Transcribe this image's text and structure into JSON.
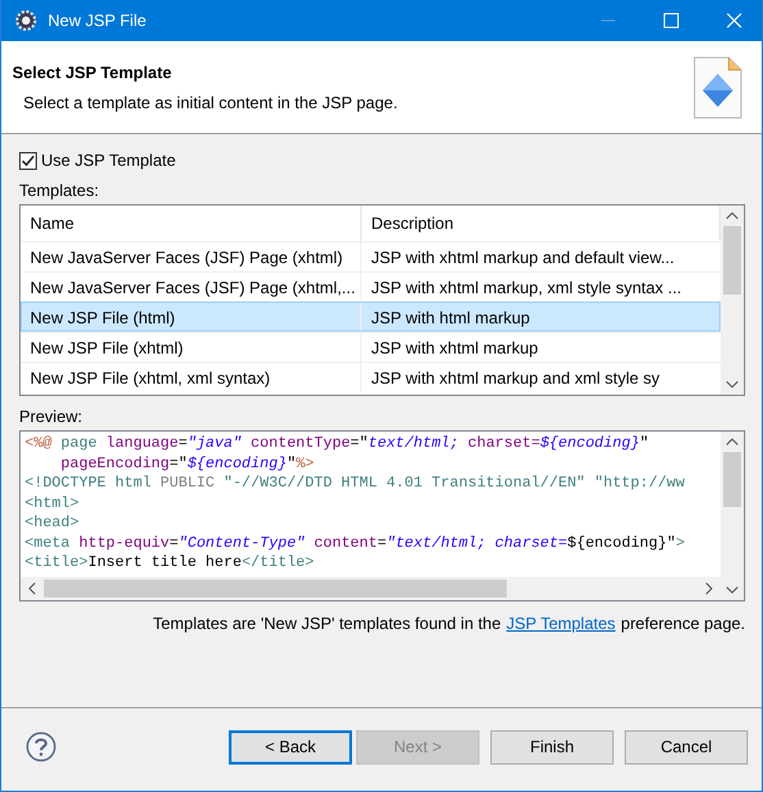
{
  "window": {
    "title": "New JSP File"
  },
  "header": {
    "title": "Select JSP Template",
    "description": "Select a template as initial content in the JSP page."
  },
  "use_template": {
    "label": "Use JSP Template",
    "checked": true
  },
  "templates_label": "Templates:",
  "table": {
    "columns": [
      "Name",
      "Description"
    ],
    "rows": [
      {
        "name": "New JavaServer Faces (JSF) Page (xhtml)",
        "description": "JSP with xhtml markup and default view...",
        "selected": false
      },
      {
        "name": "New JavaServer Faces (JSF) Page (xhtml,...",
        "description": "JSP with xhtml markup, xml style syntax ...",
        "selected": false
      },
      {
        "name": "New JSP File (html)",
        "description": "JSP with html markup",
        "selected": true
      },
      {
        "name": "New JSP File (xhtml)",
        "description": "JSP with xhtml markup",
        "selected": false
      },
      {
        "name": "New JSP File (xhtml, xml syntax)",
        "description": "JSP with xhtml markup and xml style sy",
        "selected": false
      }
    ]
  },
  "preview_label": "Preview:",
  "preview_lines": [
    [
      {
        "text": "<%@",
        "kind": "delim"
      },
      {
        "text": " page ",
        "kind": "tag"
      },
      {
        "text": "language",
        "kind": "attr"
      },
      {
        "text": "=",
        "kind": "plain"
      },
      {
        "text": "\"java\"",
        "kind": "value"
      },
      {
        "text": " contentType",
        "kind": "attr"
      },
      {
        "text": "=\"",
        "kind": "plain"
      },
      {
        "text": "text/html;",
        "kind": "value"
      },
      {
        "text": " charset=",
        "kind": "attr"
      },
      {
        "text": "${encoding}",
        "kind": "value"
      },
      {
        "text": "\"",
        "kind": "plain"
      }
    ],
    [
      {
        "text": "    pageEncoding",
        "kind": "attr"
      },
      {
        "text": "=\"",
        "kind": "plain"
      },
      {
        "text": "${encoding}",
        "kind": "value"
      },
      {
        "text": "\"",
        "kind": "plain"
      },
      {
        "text": "%>",
        "kind": "delim"
      }
    ],
    [
      {
        "text": "<!DOCTYPE html",
        "kind": "tag"
      },
      {
        "text": " PUBLIC ",
        "kind": "muted"
      },
      {
        "text": "\"-//W3C//DTD HTML 4.01 Transitional//EN\" \"http://ww",
        "kind": "tag"
      }
    ],
    [
      {
        "text": "<html>",
        "kind": "tag"
      }
    ],
    [
      {
        "text": "<head>",
        "kind": "tag"
      }
    ],
    [
      {
        "text": "<meta",
        "kind": "tag"
      },
      {
        "text": " http-equiv",
        "kind": "attr"
      },
      {
        "text": "=",
        "kind": "plain"
      },
      {
        "text": "\"Content-Type\"",
        "kind": "value"
      },
      {
        "text": " content",
        "kind": "attr"
      },
      {
        "text": "=",
        "kind": "plain"
      },
      {
        "text": "\"text/html; charset=",
        "kind": "value"
      },
      {
        "text": "${encoding}\"",
        "kind": "plain"
      },
      {
        "text": ">",
        "kind": "tag"
      }
    ],
    [
      {
        "text": "<title>",
        "kind": "tag"
      },
      {
        "text": "Insert title here",
        "kind": "plain"
      },
      {
        "text": "</title>",
        "kind": "tag"
      }
    ]
  ],
  "note": {
    "before": "Templates are 'New JSP' templates found in the",
    "link": "JSP Templates",
    "after": "preference page."
  },
  "buttons": [
    {
      "label": "< Back",
      "disabled": false,
      "focused": true
    },
    {
      "label": "Next >",
      "disabled": true,
      "focused": false
    },
    {
      "label": "Finish",
      "disabled": false,
      "focused": false
    },
    {
      "label": "Cancel",
      "disabled": false,
      "focused": false
    }
  ]
}
